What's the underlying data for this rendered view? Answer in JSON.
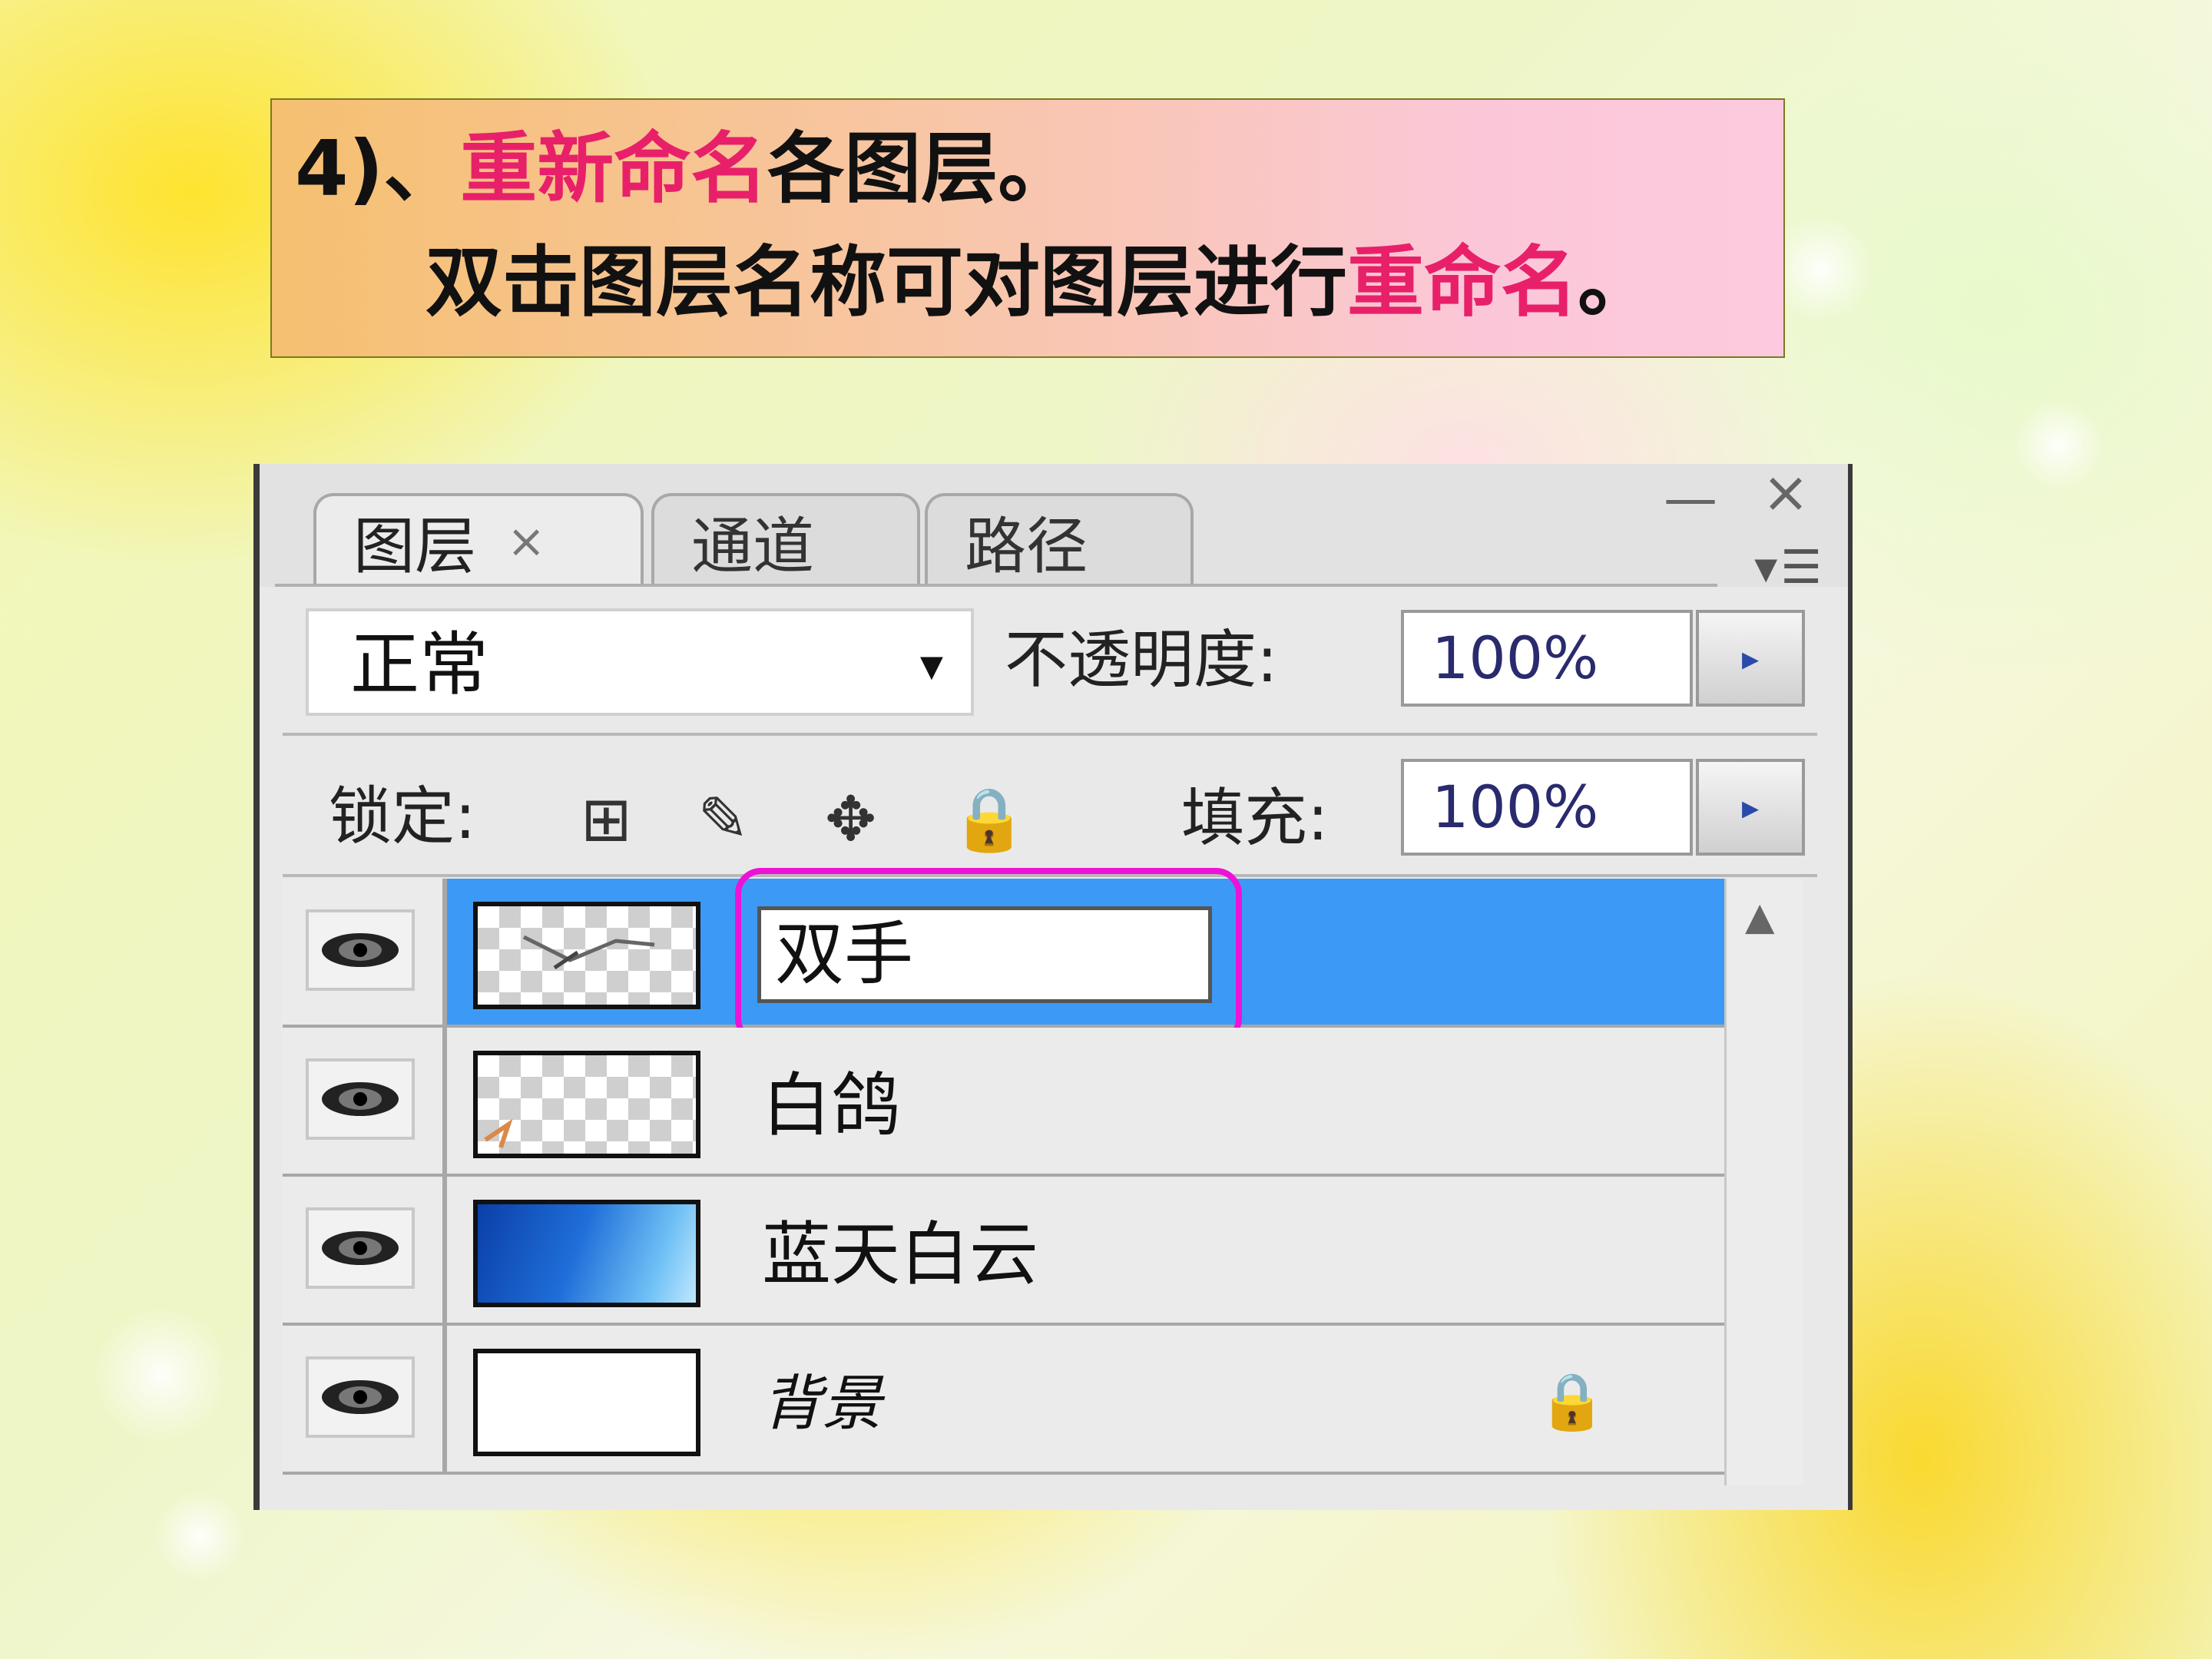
{
  "slide": {
    "title_prefix": "4)、",
    "title_highlight": "重新命名",
    "title_suffix": "各图层。",
    "subtitle_prefix": "双击图层名称可对图层进行",
    "subtitle_highlight": "重命名",
    "subtitle_suffix": "。"
  },
  "panel": {
    "tabs": [
      {
        "label": "图层",
        "close": "×"
      },
      {
        "label": "通道"
      },
      {
        "label": "路径"
      }
    ],
    "window_minimize": "—",
    "window_close": "×",
    "menu_glyph": "▾☰",
    "blend_mode": "正常",
    "blend_arrow": "▾",
    "opacity_label": "不透明度:",
    "opacity_value": "100%",
    "lock_label": "锁定:",
    "lock_icons": [
      "⊞",
      "✎",
      "✥",
      "🔒"
    ],
    "fill_label": "填充:",
    "fill_value": "100%",
    "stepper_glyph": "▸",
    "scroll_up": "▲",
    "layers": [
      {
        "name": "双手",
        "selected": true,
        "editing": true
      },
      {
        "name": "白鸽"
      },
      {
        "name": "蓝天白云"
      },
      {
        "name": "背景",
        "locked": true,
        "lock_glyph": "🔒"
      }
    ],
    "eye_glyph": "◉"
  },
  "colors": {
    "highlight_text": "#e8206a",
    "selection": "#3c9af6",
    "rename_outline": "#ee12d8"
  }
}
